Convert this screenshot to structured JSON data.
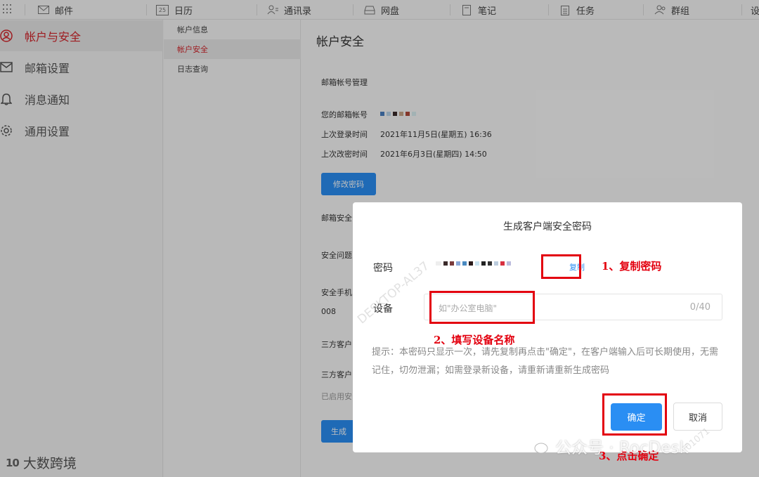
{
  "nav": {
    "items": [
      {
        "label": "邮件",
        "icon": "mail-icon"
      },
      {
        "label": "日历",
        "icon": "calendar-icon",
        "badge": "25"
      },
      {
        "label": "通讯录",
        "icon": "contacts-icon"
      },
      {
        "label": "网盘",
        "icon": "drive-icon"
      },
      {
        "label": "笔记",
        "icon": "notes-icon"
      },
      {
        "label": "任务",
        "icon": "tasks-icon"
      },
      {
        "label": "群组",
        "icon": "group-icon"
      },
      {
        "label": "设"
      }
    ]
  },
  "sidebar": {
    "items": [
      {
        "label": "帐户与安全",
        "icon": "user-shield-icon"
      },
      {
        "label": "邮箱设置",
        "icon": "mail-settings-icon"
      },
      {
        "label": "消息通知",
        "icon": "bell-icon"
      },
      {
        "label": "通用设置",
        "icon": "gear-icon"
      }
    ],
    "brand": "大数跨境",
    "brand_logo": "10"
  },
  "submenu": {
    "items": [
      "帐户信息",
      "帐户安全",
      "日志查询"
    ]
  },
  "main": {
    "title": "帐户安全",
    "section_mail": "邮箱帐号管理",
    "account_label": "您的邮箱帐号",
    "last_login_label": "上次登录时间",
    "last_login_value": "2021年11月5日(星期五) 16:36",
    "last_pwd_label": "上次改密时间",
    "last_pwd_value": "2021年6月3日(星期四) 14:50",
    "change_pwd_button": "修改密码",
    "sec_partial_1": "邮箱安全",
    "sec_partial_2": "安全问题",
    "sec_partial_3": "安全手机",
    "phone_partial": "008",
    "sec_partial_4": "三方客户",
    "sec_partial_5": "三方客户",
    "enabled_partial": "已启用安",
    "gen_button_partial": "生成"
  },
  "modal": {
    "title": "生成客户端安全密码",
    "password_label": "密码",
    "copy_label": "复制",
    "device_label": "设备",
    "device_placeholder": "如\"办公室电脑\"",
    "device_count": "0/40",
    "tip": "提示：本密码只显示一次，请先复制再点击\"确定\"，在客户端输入后可长期使用，无需记住，切勿泄漏；如需登录新设备，请重新请重新生成密码",
    "ok_button": "确定",
    "cancel_button": "取消"
  },
  "annotations": {
    "step1": "1、复制密码",
    "step2": "2、填写设备名称",
    "step3": "3、点击确定"
  },
  "watermarks": {
    "device": "DESKTOP-AL37",
    "corner": "01071",
    "wechat": "公众号 · RocDesk"
  },
  "colors": {
    "accent": "#2a8ef3",
    "active_red": "#d3252b",
    "annotation_red": "#e3000f"
  }
}
